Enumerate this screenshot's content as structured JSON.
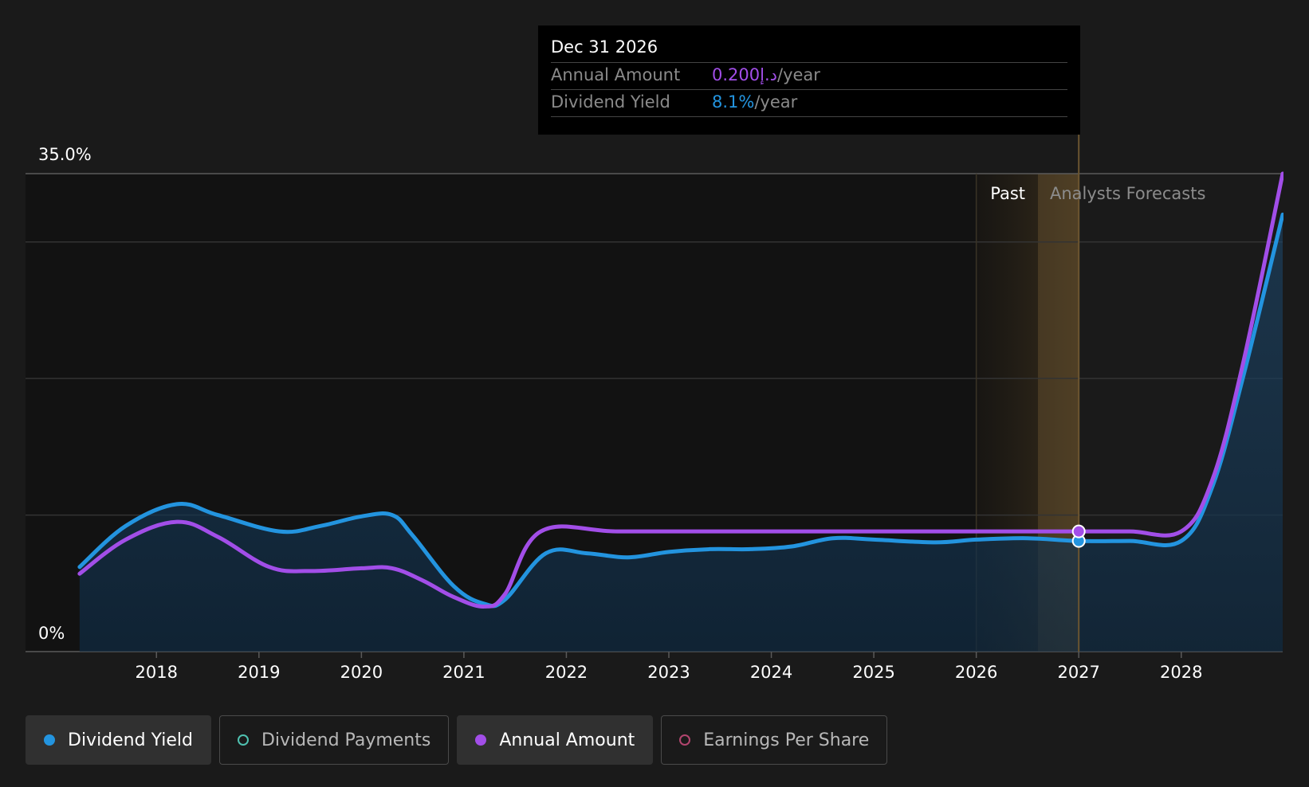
{
  "tooltip": {
    "date": "Dec 31 2026",
    "rows": [
      {
        "label": "Annual Amount",
        "value": "0.200د.إ",
        "unit": "/year"
      },
      {
        "label": "Dividend Yield",
        "value": "8.1%",
        "unit": "/year"
      }
    ]
  },
  "regions": {
    "past": "Past",
    "forecast": "Analysts Forecasts"
  },
  "legend": [
    {
      "label": "Dividend Yield",
      "color": "#2394df",
      "active": true
    },
    {
      "label": "Dividend Payments",
      "color": "#4fc1b0",
      "active": false
    },
    {
      "label": "Annual Amount",
      "color": "#a24ee8",
      "active": true
    },
    {
      "label": "Earnings Per Share",
      "color": "#b2456e",
      "active": false
    }
  ],
  "chart_data": {
    "type": "line",
    "y_tick_labels": [
      "35.0%",
      "0%"
    ],
    "ylim": [
      0,
      35
    ],
    "x_ticks": [
      "2018",
      "2019",
      "2020",
      "2021",
      "2022",
      "2023",
      "2024",
      "2025",
      "2026",
      "2027",
      "2028"
    ],
    "xlim": [
      2017.22,
      2028.99
    ],
    "past_end": 2027.0,
    "forecast_band_start": 2026.0,
    "highlight_x": 2027.0,
    "series": [
      {
        "name": "Dividend Yield",
        "color": "#2394df",
        "area": true,
        "points": [
          [
            2017.25,
            6.2
          ],
          [
            2017.7,
            9.2
          ],
          [
            2018.2,
            10.8
          ],
          [
            2018.6,
            10.0
          ],
          [
            2019.2,
            8.8
          ],
          [
            2019.6,
            9.2
          ],
          [
            2020.0,
            9.9
          ],
          [
            2020.3,
            10.0
          ],
          [
            2020.5,
            8.5
          ],
          [
            2020.9,
            4.8
          ],
          [
            2021.2,
            3.5
          ],
          [
            2021.4,
            3.8
          ],
          [
            2021.8,
            7.2
          ],
          [
            2022.2,
            7.2
          ],
          [
            2022.6,
            6.9
          ],
          [
            2023.0,
            7.3
          ],
          [
            2023.4,
            7.5
          ],
          [
            2023.8,
            7.5
          ],
          [
            2024.2,
            7.7
          ],
          [
            2024.6,
            8.3
          ],
          [
            2025.0,
            8.2
          ],
          [
            2025.6,
            8.0
          ],
          [
            2026.0,
            8.2
          ],
          [
            2026.5,
            8.3
          ],
          [
            2027.0,
            8.1
          ],
          [
            2027.5,
            8.1
          ],
          [
            2028.0,
            8.1
          ],
          [
            2028.3,
            12.0
          ],
          [
            2028.6,
            20.0
          ],
          [
            2028.99,
            32.0
          ]
        ]
      },
      {
        "name": "Annual Amount",
        "color": "#a24ee8",
        "area": false,
        "points": [
          [
            2017.25,
            5.7
          ],
          [
            2017.7,
            8.2
          ],
          [
            2018.2,
            9.5
          ],
          [
            2018.6,
            8.4
          ],
          [
            2019.1,
            6.2
          ],
          [
            2019.5,
            5.9
          ],
          [
            2020.0,
            6.1
          ],
          [
            2020.3,
            6.1
          ],
          [
            2020.6,
            5.2
          ],
          [
            2020.9,
            4.0
          ],
          [
            2021.2,
            3.3
          ],
          [
            2021.4,
            4.2
          ],
          [
            2021.75,
            8.8
          ],
          [
            2022.5,
            8.8
          ],
          [
            2023.5,
            8.8
          ],
          [
            2024.5,
            8.8
          ],
          [
            2025.5,
            8.8
          ],
          [
            2026.5,
            8.8
          ],
          [
            2027.0,
            8.8
          ],
          [
            2027.5,
            8.8
          ],
          [
            2028.0,
            8.8
          ],
          [
            2028.3,
            12.5
          ],
          [
            2028.6,
            21.0
          ],
          [
            2028.99,
            35.0
          ]
        ]
      }
    ]
  }
}
